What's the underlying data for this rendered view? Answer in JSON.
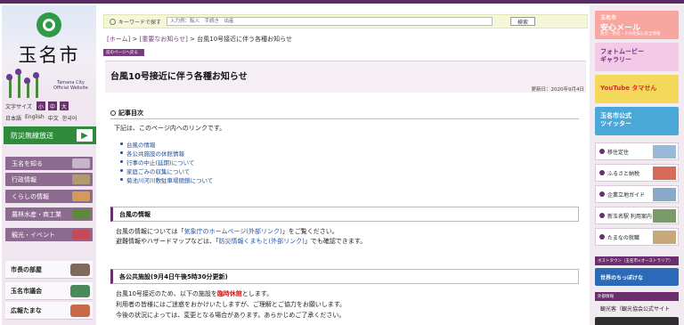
{
  "sidebar_left": {
    "city_name": "玉名市",
    "logo_sub": "Tamana City\nOfficial Website",
    "font_size_label": "文字サイズ",
    "font_sizes": [
      "小",
      "中",
      "大"
    ],
    "languages": [
      "日本語",
      "English",
      "中文",
      "한국어"
    ],
    "bousai": "防災無線放送",
    "nav": [
      "玉名を知る",
      "行政情報",
      "くらしの情報",
      "農林水産・商工業",
      "観光・イベント"
    ],
    "links": [
      "市長の部屋",
      "玉名市議会",
      "広報たまな"
    ]
  },
  "search": {
    "label": "キーワードで探す",
    "placeholder": "入力例：転入　手続き　出産",
    "button": "検索"
  },
  "breadcrumb": {
    "home": "[ホーム]",
    "sep1": " > ",
    "important": "[重要なお知らせ]",
    "sep2": " > ",
    "current": "台風10号接近に伴う各種お知らせ"
  },
  "back_button": "前のページへ戻る",
  "page_title": "台風10号接近に伴う各種お知らせ",
  "updated": "更新日：2020年9月4日",
  "toc": {
    "heading": "記事目次",
    "intro": "下記は、このページ内へのリンクです。",
    "items": [
      "台風の情報",
      "各公共施設の休館情報",
      "行事の中止(延期)について",
      "家庭ごみの収集について",
      "菊池川河川敷駐車場閉鎖について"
    ]
  },
  "sec1": {
    "heading": "台風の情報",
    "line1_pre": "台風の情報については「",
    "line1_link": "気象庁のホームページ(外部リンク)",
    "line1_post": "」をご覧ください。",
    "line2_pre": "避難情報やハザードマップなどは、「",
    "line2_link": "防災情報くまもと(外部リンク)",
    "line2_post": "」でも確認できます。"
  },
  "sec2": {
    "heading": "各公共施設(9月4日午後5時30分更新)",
    "line1_pre": "台風10号接近のため、以下の施設を",
    "line1_red": "臨時休館",
    "line1_post": "とします。",
    "line2": "利用者の皆様にはご迷惑をおかけいたしますが、ご理解とご協力をお願いします。",
    "line3": "今後の状況によっては、変更となる場合があります。あらかじめご了承ください。"
  },
  "sidebar_right": {
    "banners": [
      {
        "t1": "玉名市",
        "t2": "安心メール",
        "t3": "防災・防犯・その他安心安全情報"
      },
      {
        "t1": "",
        "t2": "フォトムービー\nギャラリー",
        "t3": ""
      },
      {
        "t1": "",
        "t2": "YouTube タマせん",
        "t3": ""
      },
      {
        "t1": "",
        "t2": "玉名市公式\nツイッター",
        "t3": ""
      }
    ],
    "links": [
      "移住定住",
      "ふるさと納税",
      "企業立地ガイド",
      "新玉名駅 利用案内",
      "たまなの就職"
    ],
    "head1": "ホストタウン（玉名市×オーストラリア）",
    "host_banner": "世界のちっぽけな",
    "head2": "外部情報",
    "kanko": "観光客（観光協会公式サイト"
  }
}
